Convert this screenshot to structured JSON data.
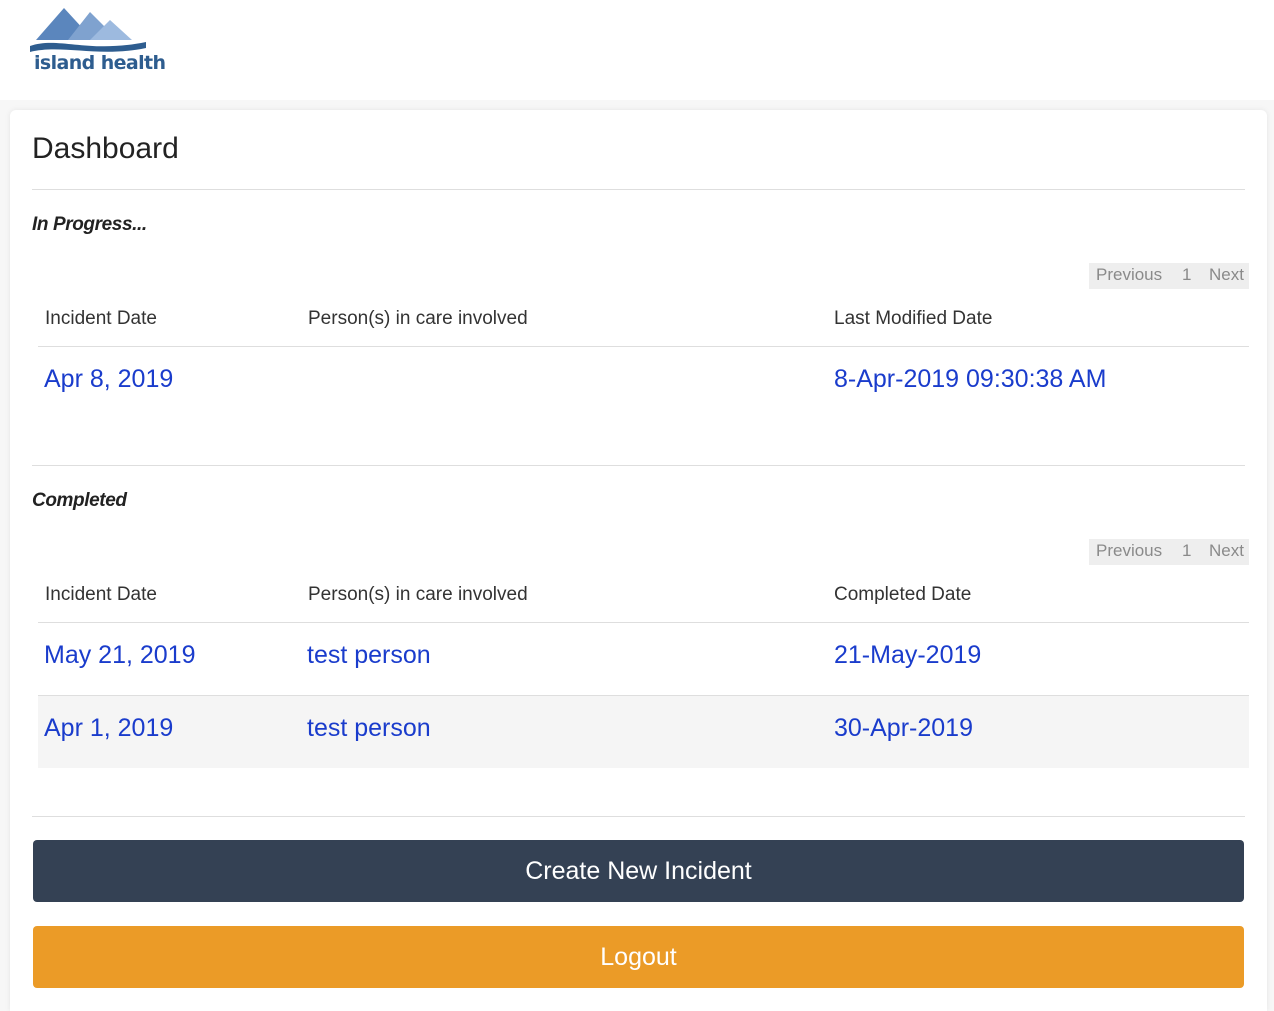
{
  "brand": {
    "name": "island health"
  },
  "dashboard": {
    "title": "Dashboard",
    "in_progress": {
      "title": "In Progress...",
      "pager": {
        "previous": "Previous",
        "page": "1",
        "next": "Next"
      },
      "columns": [
        "Incident Date",
        "Person(s) in care involved",
        "Last Modified Date"
      ],
      "rows": [
        {
          "incident_date": "Apr 8, 2019",
          "persons": "",
          "modified": "8-Apr-2019 09:30:38 AM"
        }
      ]
    },
    "completed": {
      "title": "Completed",
      "pager": {
        "previous": "Previous",
        "page": "1",
        "next": "Next"
      },
      "columns": [
        "Incident Date",
        "Person(s) in care involved",
        "Completed Date"
      ],
      "rows": [
        {
          "incident_date": "May 21, 2019",
          "persons": "test person",
          "completed": "21-May-2019"
        },
        {
          "incident_date": "Apr 1, 2019",
          "persons": "test person",
          "completed": "30-Apr-2019"
        }
      ]
    },
    "buttons": {
      "create": "Create New Incident",
      "logout": "Logout"
    }
  },
  "colors": {
    "link": "#1a3ccc",
    "create_button": "#344154",
    "logout_button": "#eb9b27",
    "brand_text": "#2e5d8f"
  }
}
